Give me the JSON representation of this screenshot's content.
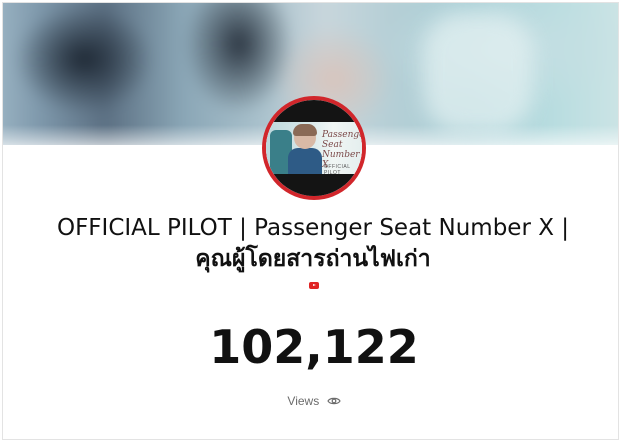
{
  "video": {
    "title_line1": "OFFICIAL PILOT | Passenger Seat Number X |",
    "title_line2": "คุณผู้โดยสารถ่านไฟเก่า"
  },
  "thumbnail": {
    "script_text": "Passenger Seat Number X",
    "official_text": "OFFICIAL PILOT"
  },
  "stats": {
    "view_count": "102,122",
    "views_label": "Views"
  },
  "icons": {
    "platform": "youtube-icon",
    "views": "eye-icon"
  },
  "colors": {
    "avatar_ring": "#d1262b",
    "youtube_red": "#e02424",
    "text": "#111111",
    "muted_text": "#6b6b6b"
  }
}
